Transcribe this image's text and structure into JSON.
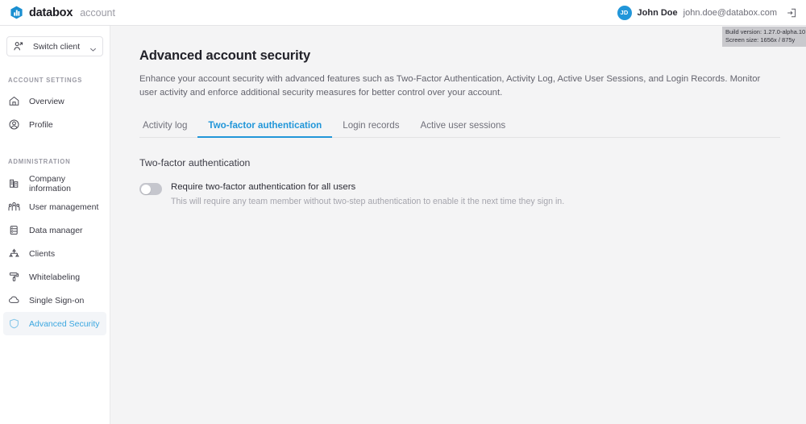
{
  "topbar": {
    "brand_name": "databox",
    "brand_sub": "account",
    "logo_icon": "databox-bar-chart-logo",
    "user": {
      "initials": "JD",
      "name": "John Doe",
      "email": "john.doe@databox.com"
    },
    "signout_icon": "sign-out-icon"
  },
  "build_info": {
    "version_line": "Build version: 1.27.0-alpha.10",
    "screen_line": "Screen size: 1656x / 875y"
  },
  "sidebar": {
    "switch_client": {
      "label": "Switch client",
      "icon": "switch-client-icon",
      "chevron": "chevron-down-icon"
    },
    "sections": [
      {
        "title": "ACCOUNT SETTINGS",
        "items": [
          {
            "label": "Overview",
            "icon": "home-icon",
            "active": false
          },
          {
            "label": "Profile",
            "icon": "user-circle-icon",
            "active": false
          }
        ]
      },
      {
        "title": "ADMINISTRATION",
        "items": [
          {
            "label": "Company information",
            "icon": "building-icon",
            "active": false
          },
          {
            "label": "User management",
            "icon": "users-icon",
            "active": false
          },
          {
            "label": "Data manager",
            "icon": "database-icon",
            "active": false
          },
          {
            "label": "Clients",
            "icon": "org-chart-icon",
            "active": false
          },
          {
            "label": "Whitelabeling",
            "icon": "paint-roller-icon",
            "active": false
          },
          {
            "label": "Single Sign-on",
            "icon": "cloud-icon",
            "active": false
          },
          {
            "label": "Advanced Security",
            "icon": "shield-icon",
            "active": true
          }
        ]
      }
    ]
  },
  "main": {
    "title": "Advanced account security",
    "description": "Enhance your account security with advanced features such as Two-Factor Authentication, Activity Log, Active User Sessions, and Login Records. Monitor user activity and enforce additional security measures for better control over your account.",
    "tabs": [
      {
        "label": "Activity log",
        "active": false
      },
      {
        "label": "Two-factor authentication",
        "active": true
      },
      {
        "label": "Login records",
        "active": false
      },
      {
        "label": "Active user sessions",
        "active": false
      }
    ],
    "section_title": "Two-factor authentication",
    "toggle": {
      "label": "Require two-factor authentication for all users",
      "hint": "This will require any team member without two-step authentication to enable it the next time they sign in.",
      "state": "off"
    }
  },
  "colors": {
    "accent": "#2196d9",
    "page_bg": "#f4f4f5",
    "sidebar_bg": "#ffffff",
    "active_nav_bg": "#f3f5f8",
    "toggle_off": "#c5c6cd",
    "build_info_bg": "#c9c9cd"
  }
}
